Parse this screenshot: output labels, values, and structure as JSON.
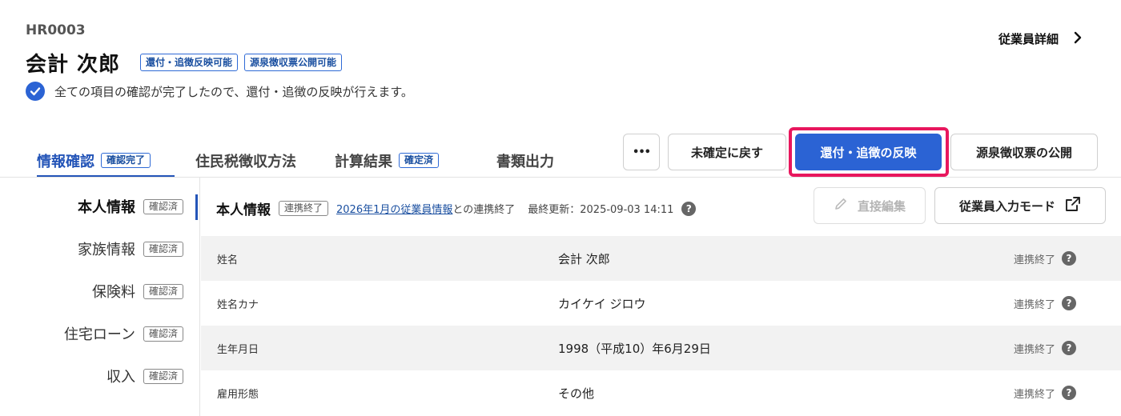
{
  "employee": {
    "id": "HR0003",
    "name": "会計 次郎",
    "badges": [
      "還付・追徴反映可能",
      "源泉徴収票公開可能"
    ],
    "notice": "全ての項目の確認が完了したので、還付・追徴の反映が行えます。"
  },
  "header": {
    "detail_link": "従業員詳細"
  },
  "tabs": [
    {
      "label": "情報確認",
      "badge": "確認完了"
    },
    {
      "label": "住民税徴収方法",
      "badge": ""
    },
    {
      "label": "計算結果",
      "badge": "確定済"
    },
    {
      "label": "書類出力",
      "badge": ""
    }
  ],
  "actions": {
    "more": "•••",
    "revert": "未確定に戻す",
    "apply": "還付・追徴の反映",
    "publish": "源泉徴収票の公開"
  },
  "nav": [
    {
      "label": "本人情報",
      "badge": "確認済"
    },
    {
      "label": "家族情報",
      "badge": "確認済"
    },
    {
      "label": "保険料",
      "badge": "確認済"
    },
    {
      "label": "住宅ローン",
      "badge": "確認済"
    },
    {
      "label": "収入",
      "badge": "確認済"
    }
  ],
  "section": {
    "title": "本人情報",
    "status_badge": "連携終了",
    "link_text": "2026年1月の従業員情報",
    "link_suffix": "との連携終了",
    "last_updated": "最終更新：2025-09-03 14:11",
    "edit_button": "直接編集",
    "input_mode_button": "従業員入力モード"
  },
  "rows": [
    {
      "label": "姓名",
      "value": "会計 次郎",
      "status": "連携終了"
    },
    {
      "label": "姓名カナ",
      "value": "カイケイ ジロウ",
      "status": "連携終了"
    },
    {
      "label": "生年月日",
      "value": "1998（平成10）年6月29日",
      "status": "連携終了"
    },
    {
      "label": "雇用形態",
      "value": "その他",
      "status": "連携終了"
    }
  ]
}
